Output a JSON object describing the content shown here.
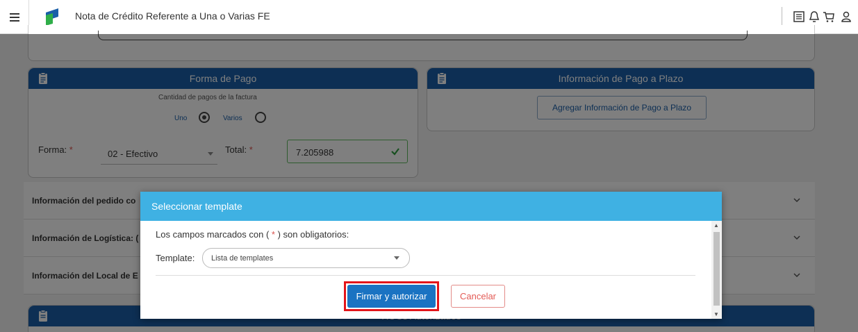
{
  "header": {
    "title": "Nota de Crédito Referente a Una o Varias FE",
    "icons": [
      "menu-icon",
      "list-icon",
      "bell-icon",
      "cart-icon",
      "user-icon"
    ]
  },
  "forma_pago": {
    "title": "Forma de Pago",
    "cantidad_label": "Cantidad de pagos de la factura",
    "option_uno": "Uno",
    "option_varios": "Varios",
    "selected": "Uno",
    "forma_label": "Forma:",
    "forma_value": "02 - Efectivo",
    "total_label": "Total:",
    "total_value": "7.205988",
    "required_mark": "*"
  },
  "pago_plazo": {
    "title": "Información de Pago a Plazo",
    "add_button": "Agregar Información de Pago a Plazo"
  },
  "accordion": [
    {
      "label": "Información del pedido co"
    },
    {
      "label": "Información de Logística: ("
    },
    {
      "label": "Información del Local de E"
    }
  ],
  "bottom_card": {
    "title": "RUCs Autorizados"
  },
  "modal": {
    "title": "Seleccionar template",
    "required_note_pre": "Los campos marcados con (",
    "required_star": " * ",
    "required_note_post": ") son obligatorios:",
    "template_label": "Template:",
    "template_placeholder": "Lista de templates",
    "sign_button": "Firmar y autorizar",
    "cancel_button": "Cancelar"
  },
  "colors": {
    "brand_blue": "#1a5fa8",
    "modal_header": "#3fb1e3",
    "primary_button": "#1a73c2",
    "highlight": "#e3151a",
    "cancel": "#e35a55",
    "valid": "#5cb85c"
  }
}
